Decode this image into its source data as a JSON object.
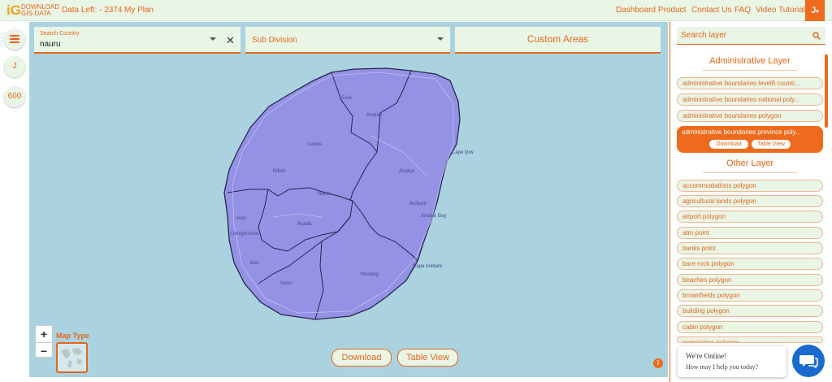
{
  "header": {
    "logo_mark": "iG",
    "logo_line1": "DOWNLOAD",
    "logo_line2": "GIS-DATA",
    "data_left": "Data Left: - 2374",
    "my_plan": "My Plan",
    "nav": [
      "Dashboard",
      "Product",
      "Contact Us",
      "FAQ",
      "Video Tutorial"
    ],
    "user_initial": "J"
  },
  "left_rail": {
    "menu_icon": "hamburger-icon",
    "user_initial": "J",
    "credits": "600"
  },
  "search": {
    "country_label": "Search Country",
    "country_value": "nauru",
    "subdivision_placeholder": "Sub Division",
    "custom_areas": "Custom Areas"
  },
  "map": {
    "labels": [
      "Anabar",
      "Anibare",
      "Nauru",
      "Buada",
      "Meneng",
      "Yaren",
      "Cape Ijuw",
      "Anetan",
      "Ewa",
      "Nibok",
      "Uaboe",
      "Denigomodu",
      "Aiwo",
      "Boe",
      "Anabar Bay",
      "Cape Anibare"
    ],
    "zoom_in": "+",
    "zoom_out": "−",
    "map_type_label": "Map Type",
    "download_label": "Download",
    "table_view_label": "Table View",
    "info": "i"
  },
  "right_panel": {
    "search_placeholder": "Search layer",
    "admin_title": "Administrative Layer",
    "admin_layers": [
      "administrative boundaries level6 counti...",
      "administrative boundaries national poly...",
      "administrative boundaries polygon"
    ],
    "active_layer": "administrative boundaries province poly...",
    "active_download": "Download",
    "active_table_view": "Table View",
    "other_title": "Other Layer",
    "other_layers": [
      "accommodations polygon",
      "agricultural lands polygon",
      "airport polygon",
      "atm point",
      "banks point",
      "bare rock polygon",
      "beaches polygon",
      "brownfields polygon",
      "building polygon",
      "cabin polygon",
      "cemeteries polygon"
    ]
  },
  "chat": {
    "line1": "We're Online!",
    "line2": "How may I help you today?"
  },
  "colors": {
    "accent": "#e8661c",
    "panel_bg": "#e9f6e6",
    "sea": "#aad3df",
    "boundary_fill": "#8f86e6",
    "chat_blue": "#1a6bd0"
  }
}
